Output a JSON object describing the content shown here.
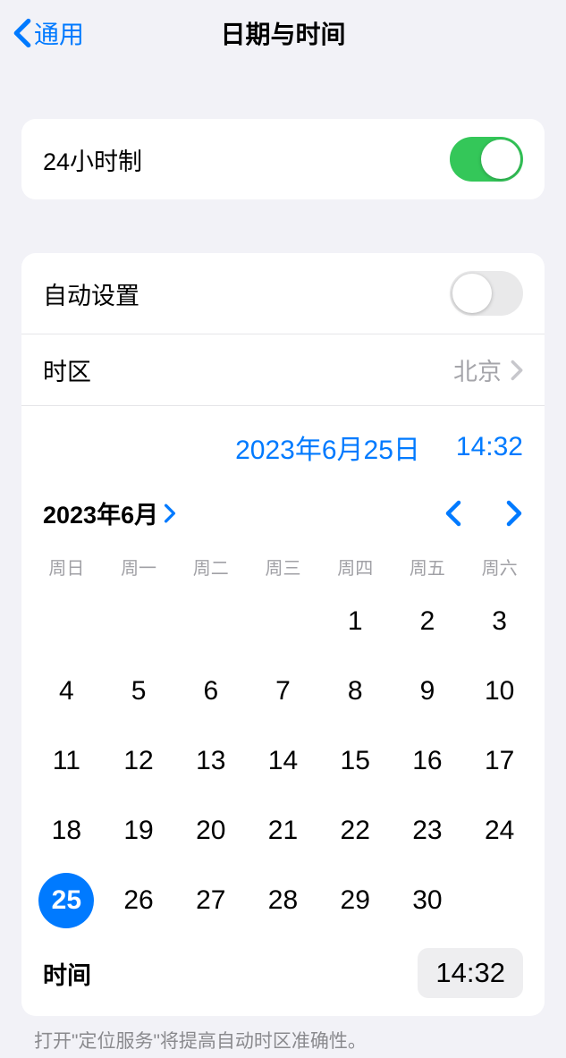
{
  "header": {
    "back_label": "通用",
    "title": "日期与时间"
  },
  "settings": {
    "clock24_label": "24小时制",
    "auto_set_label": "自动设置",
    "timezone_label": "时区",
    "timezone_value": "北京"
  },
  "datetime": {
    "date_display": "2023年6月25日",
    "time_display": "14:32"
  },
  "calendar": {
    "month_title": "2023年6月",
    "weekdays": [
      "周日",
      "周一",
      "周二",
      "周三",
      "周四",
      "周五",
      "周六"
    ],
    "weeks": [
      [
        "",
        "",
        "",
        "",
        "1",
        "2",
        "3"
      ],
      [
        "4",
        "5",
        "6",
        "7",
        "8",
        "9",
        "10"
      ],
      [
        "11",
        "12",
        "13",
        "14",
        "15",
        "16",
        "17"
      ],
      [
        "18",
        "19",
        "20",
        "21",
        "22",
        "23",
        "24"
      ],
      [
        "25",
        "26",
        "27",
        "28",
        "29",
        "30",
        ""
      ]
    ],
    "selected_day": "25",
    "time_label": "时间",
    "time_value": "14:32"
  },
  "footnote": "打开\"定位服务\"将提高自动时区准确性。"
}
